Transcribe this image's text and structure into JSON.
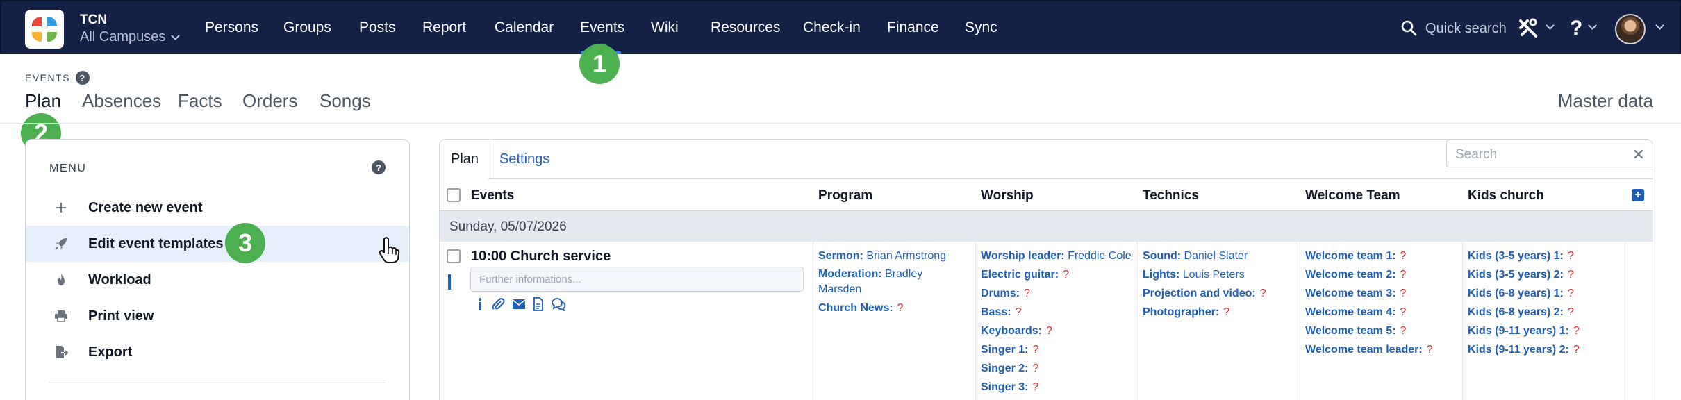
{
  "app": {
    "org_name": "TCN",
    "campus": "All Campuses",
    "nav": [
      "Persons",
      "Groups",
      "Posts",
      "Report",
      "Calendar",
      "Events",
      "Wiki",
      "Resources",
      "Check-in",
      "Finance",
      "Sync"
    ],
    "active_nav": "Events",
    "quick_search": "Quick search",
    "help_symbol": "?",
    "accent": "#142146"
  },
  "steps": [
    "1",
    "2",
    "3"
  ],
  "page": {
    "section_label": "EVENTS",
    "help_symbol": "?",
    "subtabs": [
      "Plan",
      "Absences",
      "Facts",
      "Orders",
      "Songs"
    ],
    "active_subtab": "Plan",
    "master_data": "Master data"
  },
  "menu": {
    "title": "MENU",
    "help_symbol": "?",
    "items": [
      {
        "label": "Create new event",
        "icon": "plus-icon"
      },
      {
        "label": "Edit event templates",
        "icon": "rocket-icon"
      },
      {
        "label": "Workload",
        "icon": "flame-icon"
      },
      {
        "label": "Print view",
        "icon": "printer-icon"
      },
      {
        "label": "Export",
        "icon": "export-icon"
      }
    ],
    "hovered": "Edit event templates"
  },
  "plan": {
    "tabs": [
      "Plan",
      "Settings"
    ],
    "active_tab": "Plan",
    "search_placeholder": "Search",
    "columns": [
      "Events",
      "Program",
      "Worship",
      "Technics",
      "Welcome Team",
      "Kids church"
    ],
    "date": "Sunday, 05/07/2026",
    "event": {
      "title": "10:00 Church service",
      "further_placeholder": "Further informations..."
    },
    "program": [
      {
        "role": "Sermon:",
        "value": "Brian Armstrong"
      },
      {
        "role": "Moderation:",
        "value": "Bradley"
      },
      {
        "role": "",
        "value": "Marsden"
      },
      {
        "role": "Church News:",
        "value": "?"
      }
    ],
    "worship": [
      {
        "role": "Worship leader:",
        "value": "Freddie Cole"
      },
      {
        "role": "Electric guitar:",
        "value": "?"
      },
      {
        "role": "Drums:",
        "value": "?"
      },
      {
        "role": "Bass:",
        "value": "?"
      },
      {
        "role": "Keyboards:",
        "value": "?"
      },
      {
        "role": "Singer 1:",
        "value": "?"
      },
      {
        "role": "Singer 2:",
        "value": "?"
      },
      {
        "role": "Singer 3:",
        "value": "?"
      }
    ],
    "technics": [
      {
        "role": "Sound:",
        "value": "Daniel Slater"
      },
      {
        "role": "Lights:",
        "value": "Louis Peters"
      },
      {
        "role": "Projection and video:",
        "value": "?"
      },
      {
        "role": "Photographer:",
        "value": "?"
      }
    ],
    "welcome": [
      {
        "role": "Welcome team 1:",
        "value": "?"
      },
      {
        "role": "Welcome team 2:",
        "value": "?"
      },
      {
        "role": "Welcome team 3:",
        "value": "?"
      },
      {
        "role": "Welcome team 4:",
        "value": "?"
      },
      {
        "role": "Welcome team 5:",
        "value": "?"
      },
      {
        "role": "Welcome team leader:",
        "value": "?"
      }
    ],
    "kids": [
      {
        "role": "Kids (3-5 years) 1:",
        "value": "?"
      },
      {
        "role": "Kids (3-5 years) 2:",
        "value": "?"
      },
      {
        "role": "Kids (6-8 years) 1:",
        "value": "?"
      },
      {
        "role": "Kids (6-8 years) 2:",
        "value": "?"
      },
      {
        "role": "Kids (9-11 years) 1:",
        "value": "?"
      },
      {
        "role": "Kids (9-11 years) 2:",
        "value": "?"
      }
    ]
  }
}
